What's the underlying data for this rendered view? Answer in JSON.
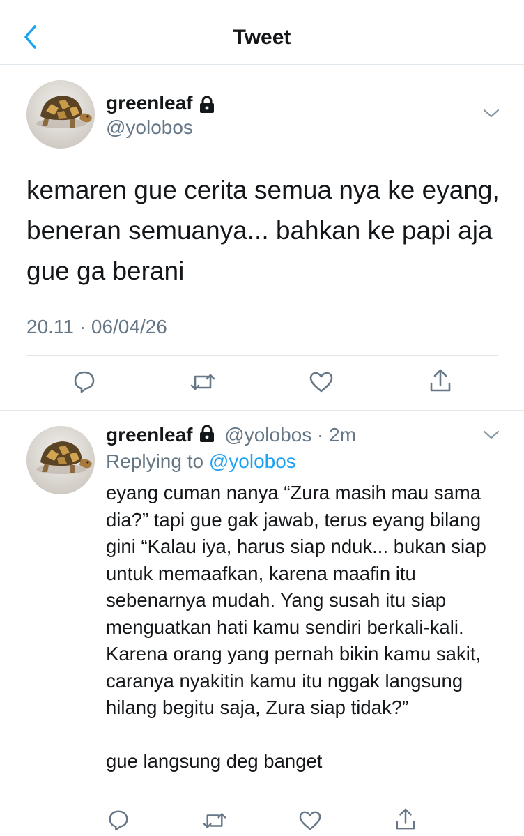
{
  "header": {
    "title": "Tweet",
    "back_icon": "chevron-left-icon"
  },
  "colors": {
    "accent": "#1da1f2",
    "secondary_text": "#657786",
    "divider": "#e1e8ed"
  },
  "main_tweet": {
    "display_name": "greenleaf",
    "handle": "@yolobos",
    "protected_icon": "lock-icon",
    "text": "kemaren gue cerita semua nya ke eyang, beneran semuanya... bahkan ke papi aja gue ga berani",
    "timestamp": "20.11 · 06/04/26",
    "actions": [
      "reply-icon",
      "retweet-icon",
      "like-icon",
      "share-icon"
    ]
  },
  "reply_tweet": {
    "display_name": "greenleaf",
    "handle": "@yolobos",
    "separator": "·",
    "time_ago": "2m",
    "replying_prefix": "Replying to",
    "replying_handle": "@yolobos",
    "text": "eyang cuman nanya “Zura masih mau sama dia?” tapi gue gak jawab, terus eyang bilang gini “Kalau iya, harus siap nduk... bukan siap untuk memaafkan, karena maafin itu sebenarnya mudah. Yang susah itu siap menguatkan hati kamu sendiri berkali-kali. Karena orang yang pernah bikin kamu sakit, caranya nyakitin kamu itu nggak langsung hilang begitu saja, Zura siap tidak?”\n\ngue langsung deg banget",
    "actions": [
      "reply-icon",
      "retweet-icon",
      "like-icon",
      "share-icon"
    ]
  }
}
